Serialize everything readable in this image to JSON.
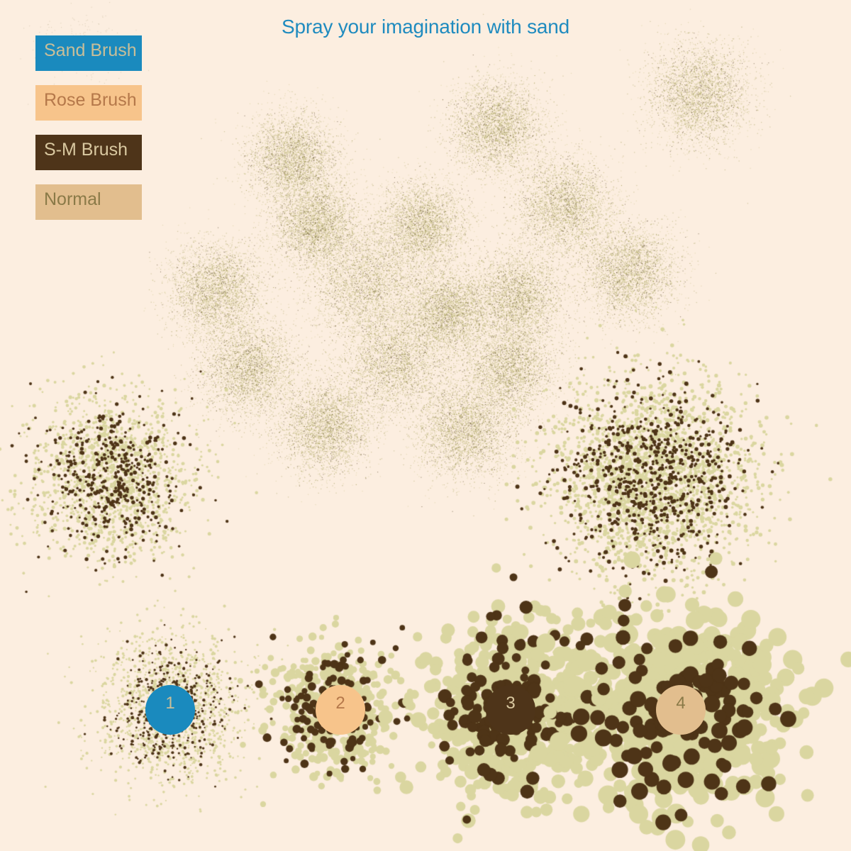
{
  "title": "Spray your imagination with sand",
  "colors": {
    "background": "#FCEEE0",
    "title": "#1F8BBF",
    "sand_light": "#DAD6A0",
    "sand_dark": "#4E3417",
    "sand_spray": "#A59F5A"
  },
  "brushes": [
    {
      "label": "Sand Brush",
      "background": "#1A8ABE",
      "text_color": "#C9BE98"
    },
    {
      "label": "Rose Brush",
      "background": "#F7C48B",
      "text_color": "#B5784A"
    },
    {
      "label": "S-M Brush",
      "background": "#4E3419",
      "text_color": "#D9C8A0"
    },
    {
      "label": "Normal",
      "background": "#E2BE8E",
      "text_color": "#8A7A48"
    }
  ],
  "sizes": [
    {
      "label": "1",
      "background": "#1A8ABE",
      "text_color": "#C9BE98"
    },
    {
      "label": "2",
      "background": "#F7C48B",
      "text_color": "#B5784A"
    },
    {
      "label": "3",
      "background": "#4E3419",
      "text_color": "#D9C8A0"
    },
    {
      "label": "4",
      "background": "#E2BE8E",
      "text_color": "#8A7A48"
    }
  ]
}
